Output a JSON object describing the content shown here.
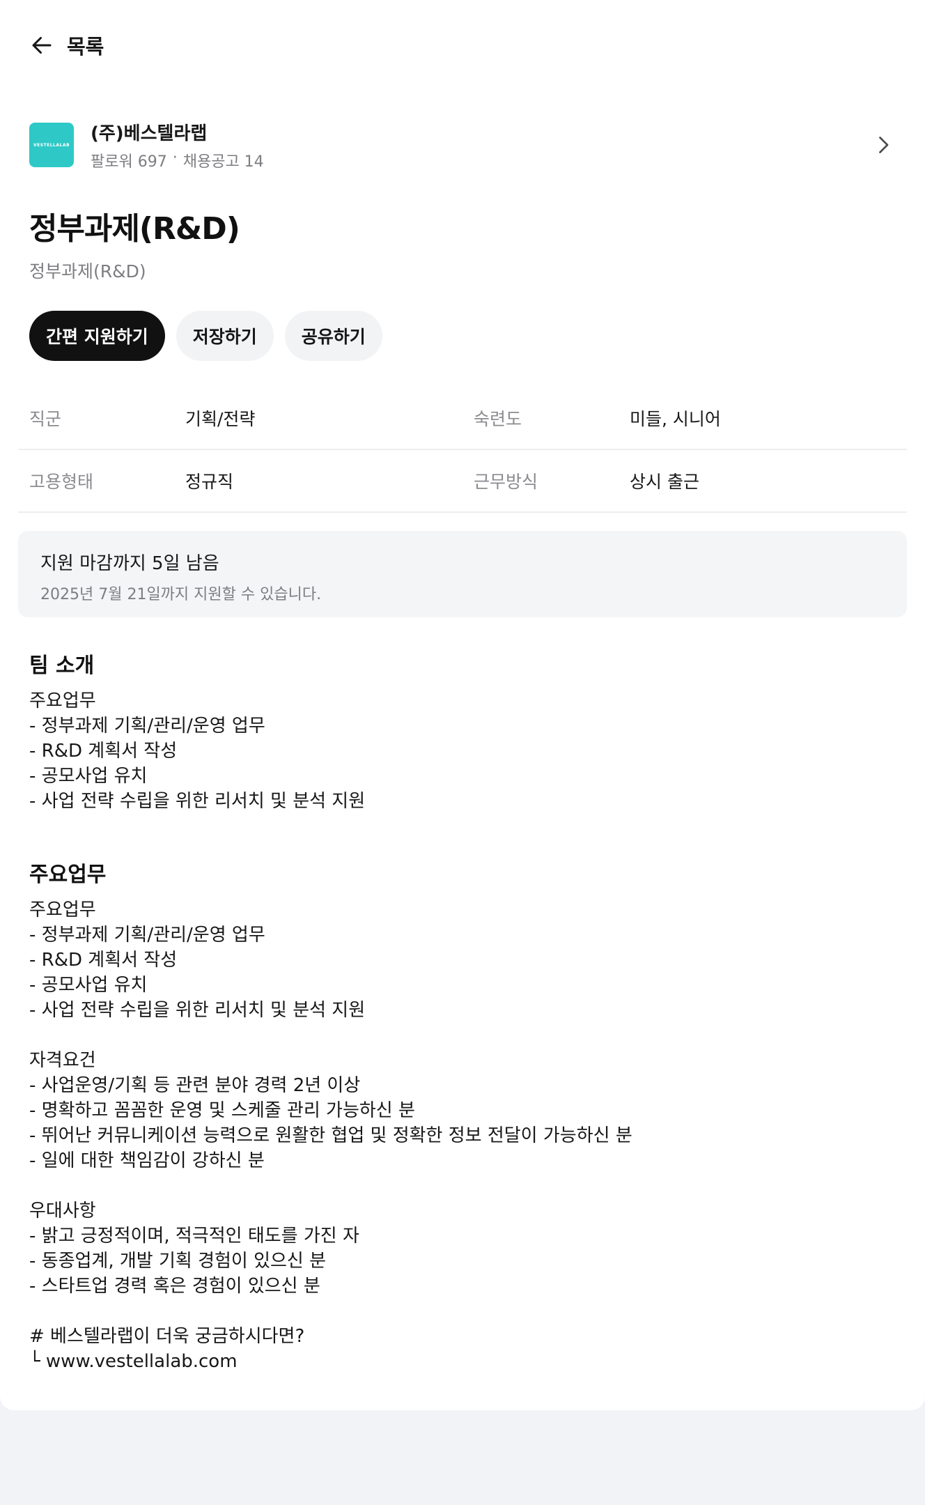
{
  "nav": {
    "back_label": "목록"
  },
  "company": {
    "logo_text": "VESTELLALAB",
    "name": "(주)베스텔라랩",
    "followers": "팔로워 697",
    "separator": "·",
    "postings": "채용공고 14"
  },
  "job": {
    "title": "정부과제(R&D)",
    "subtitle": "정부과제(R&D)"
  },
  "actions": {
    "apply": "간편 지원하기",
    "save": "저장하기",
    "share": "공유하기"
  },
  "info": [
    {
      "label1": "직군",
      "value1": "기획/전략",
      "label2": "숙련도",
      "value2": "미들, 시니어"
    },
    {
      "label1": "고용형태",
      "value1": "정규직",
      "label2": "근무방식",
      "value2": "상시 출근"
    }
  ],
  "deadline": {
    "title": "지원 마감까지 5일 남음",
    "subtitle": "2025년 7월 21일까지 지원할 수 있습니다."
  },
  "team_section": {
    "title": "팀 소개",
    "lines": [
      "주요업무",
      "- 정부과제 기획/관리/운영 업무",
      "- R&D 계획서 작성",
      "- 공모사업 유치",
      "- 사업 전략 수립을 위한 리서치 및 분석 지원"
    ]
  },
  "duties_section": {
    "title": "주요업무",
    "lines": [
      "주요업무",
      "- 정부과제 기획/관리/운영 업무",
      "- R&D 계획서 작성",
      "- 공모사업 유치",
      "- 사업 전략 수립을 위한 리서치 및 분석 지원",
      "",
      "자격요건",
      "- 사업운영/기획 등 관련 분야 경력 2년 이상",
      "- 명확하고 꼼꼼한 운영 및 스케줄 관리 가능하신 분",
      "- 뛰어난 커뮤니케이션 능력으로 원활한 협업 및 정확한 정보 전달이 가능하신 분",
      "- 일에 대한 책임감이 강하신 분",
      "",
      "우대사항",
      "- 밝고 긍정적이며, 적극적인 태도를 가진 자",
      "- 동종업계, 개발 기획 경험이 있으신 분",
      "- 스타트업 경력 혹은 경험이 있으신 분",
      "",
      "# 베스텔라랩이 더욱 궁금하시다면?",
      "└ www.vestellalab.com"
    ]
  }
}
